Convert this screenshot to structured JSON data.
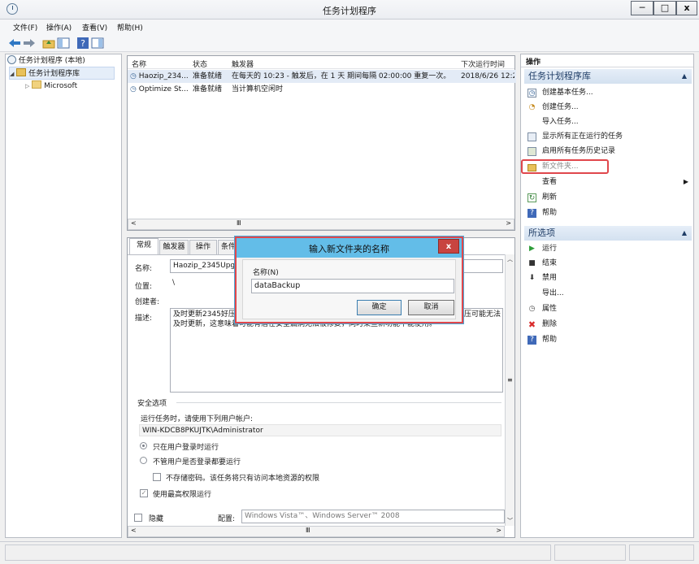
{
  "window": {
    "title": "任务计划程序",
    "minimize": "─",
    "maximize": "□",
    "close": "x"
  },
  "menu": [
    "文件(F)",
    "操作(A)",
    "查看(V)",
    "帮助(H)"
  ],
  "tree": {
    "root": "任务计划程序 (本地)",
    "library": "任务计划程序库",
    "child": "Microsoft"
  },
  "task_list": {
    "columns": [
      "名称",
      "状态",
      "触发器",
      "下次运行时间"
    ],
    "rows": [
      {
        "name": "Haozip_234...",
        "status": "准备就绪",
        "trigger": "在每天的 10:23 - 触发后，在 1 天 期间每隔 02:00:00 重复一次。",
        "next": "2018/6/26 12:2"
      },
      {
        "name": "Optimize St...",
        "status": "准备就绪",
        "trigger": "当计算机空闲时",
        "next": ""
      }
    ],
    "hscroll_thumb": "Ⅲ"
  },
  "detail": {
    "tabs": [
      "常规",
      "触发器",
      "操作",
      "条件"
    ],
    "name_label": "名称:",
    "name_value": "Haozip_2345Upg",
    "location_label": "位置:",
    "location_value": "\\",
    "author_label": "创建者:",
    "desc_label": "描述:",
    "desc_line1": "及时更新2345好压",
    "desc_line1_tail": "压可能无法",
    "desc_line2": "及时更新，这意味着可能有潜在安全漏洞无法被修复，同时某些新功能不能使用。",
    "security_title": "安全选项",
    "run_as_label": "运行任务时，请使用下列用户帐户:",
    "run_as_user": "WIN-KDCB8PKUJTK\\Administrator",
    "opt_logged_on": "只在用户登录时运行",
    "opt_whether": "不管用户是否登录都要运行",
    "opt_no_store": "不存储密码。该任务将只有访问本地资源的权限",
    "opt_highest": "使用最高权限运行",
    "hidden_label": "隐藏",
    "config_label": "配置:",
    "config_value": "Windows Vista™、Windows Server™ 2008",
    "check_mark": "✓",
    "scroll_thumb": "Ⅲ"
  },
  "actions": {
    "title": "操作",
    "section1": "任务计划程序库",
    "items1": [
      "创建基本任务...",
      "创建任务...",
      "导入任务...",
      "显示所有正在运行的任务",
      "启用所有任务历史记录",
      "新文件夹...",
      "查看",
      "刷新",
      "帮助"
    ],
    "section2": "所选项",
    "items2": [
      "运行",
      "结束",
      "禁用",
      "导出...",
      "属性",
      "删除",
      "帮助"
    ]
  },
  "dialog": {
    "title": "输入新文件夹的名称",
    "close": "x",
    "field_label": "名称(N)",
    "field_value": "dataBackup",
    "ok": "确定",
    "cancel": "取消"
  },
  "colors": {
    "accent": "#63bde8",
    "highlight_border": "#e0474c",
    "section_header": "#d4e1f0"
  }
}
